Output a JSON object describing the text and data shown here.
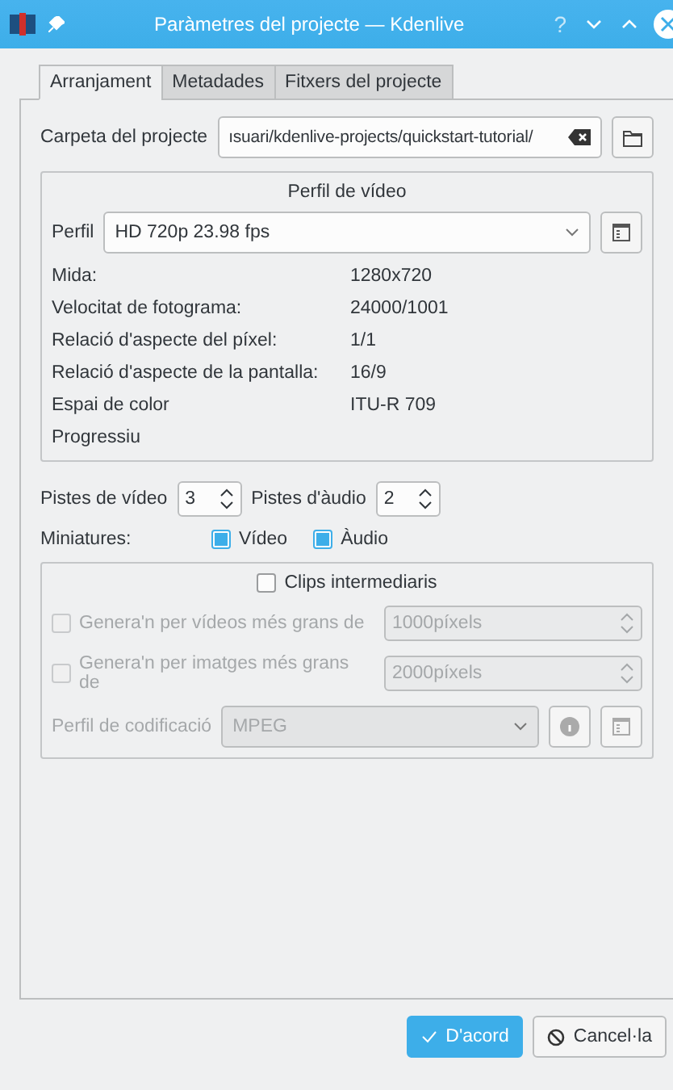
{
  "window": {
    "title": "Paràmetres del projecte — Kdenlive",
    "help": "?"
  },
  "tabs": [
    {
      "label": "Arranjament",
      "selected": true
    },
    {
      "label": "Metadades",
      "selected": false
    },
    {
      "label": "Fitxers del projecte",
      "selected": false
    }
  ],
  "project_folder": {
    "label": "Carpeta del projecte",
    "value": "ısuari/kdenlive-projects/quickstart-tutorial/"
  },
  "video_profile": {
    "title": "Perfil de vídeo",
    "label": "Perfil",
    "value": "HD 720p 23.98 fps",
    "properties": [
      {
        "name": "Mida:",
        "value": "1280x720"
      },
      {
        "name": "Velocitat de fotograma:",
        "value": "24000/1001"
      },
      {
        "name": "Relació d'aspecte del píxel:",
        "value": "1/1"
      },
      {
        "name": "Relació d'aspecte de la pantalla:",
        "value": "16/9"
      },
      {
        "name": "Espai de color",
        "value": "ITU-R 709"
      },
      {
        "name": "Progressiu"
      }
    ]
  },
  "tracks": [
    {
      "label": "Pistes de vídeo",
      "value": "3"
    },
    {
      "label": "Pistes d'àudio",
      "value": "2"
    }
  ],
  "thumbnails": {
    "label": "Miniatures:",
    "options": [
      {
        "label": "Vídeo",
        "checked": true
      },
      {
        "label": "Àudio",
        "checked": true
      }
    ]
  },
  "proxy": {
    "label": "Clips intermediaris",
    "checked": false,
    "rows": [
      {
        "label": "Genera'n per vídeos més grans de",
        "checked": false,
        "value": "1000píxels",
        "disabled": true
      },
      {
        "label": "Genera'n per imatges més grans de",
        "checked": false,
        "value": "2000píxels",
        "disabled": true
      }
    ],
    "encoding": {
      "label": "Perfil de codificació",
      "value": "MPEG",
      "disabled": true
    }
  },
  "buttons": [
    {
      "label": "D'acord",
      "kind": "primary"
    },
    {
      "label": "Cancel·la",
      "kind": "cancel"
    }
  ]
}
